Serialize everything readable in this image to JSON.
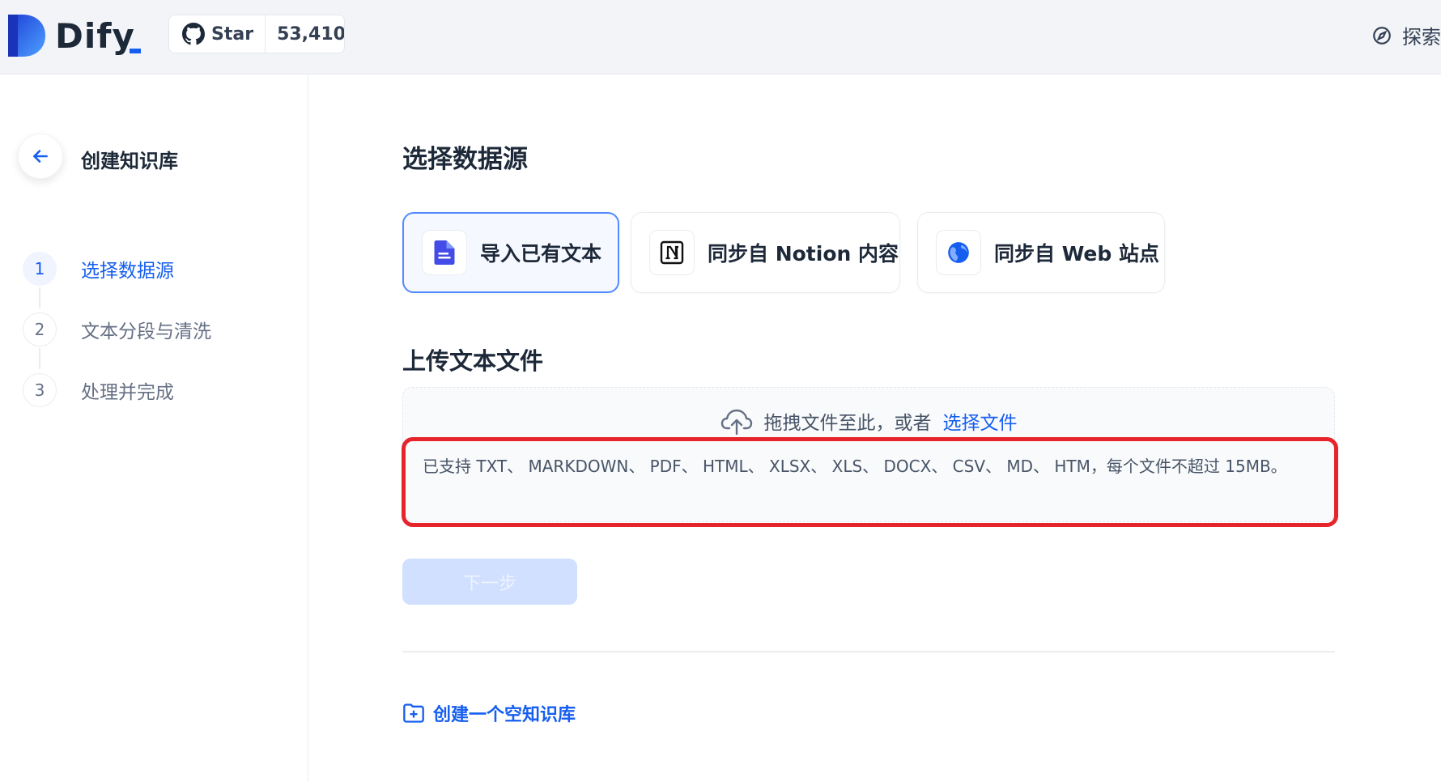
{
  "header": {
    "brand": "Dify",
    "github": {
      "star_label": "Star",
      "count": "53,410"
    },
    "explore_label": "探索"
  },
  "sidebar": {
    "title": "创建知识库",
    "steps": [
      {
        "num": "1",
        "label": "选择数据源",
        "active": true
      },
      {
        "num": "2",
        "label": "文本分段与清洗",
        "active": false
      },
      {
        "num": "3",
        "label": "处理并完成",
        "active": false
      }
    ]
  },
  "main": {
    "section_title": "选择数据源",
    "sources": [
      {
        "label": "导入已有文本",
        "icon": "file-icon",
        "active": true
      },
      {
        "label": "同步自 Notion 内容",
        "icon": "notion-icon",
        "active": false
      },
      {
        "label": "同步自 Web 站点",
        "icon": "globe-icon",
        "active": false
      }
    ],
    "upload_title": "上传文本文件",
    "dropzone": {
      "text": "拖拽文件至此，或者",
      "link": "选择文件",
      "supported": "已支持 TXT、 MARKDOWN、 PDF、 HTML、 XLSX、 XLS、 DOCX、 CSV、 MD、 HTM，每个文件不超过 15MB。"
    },
    "next_button": "下一步",
    "create_empty": "创建一个空知识库"
  },
  "colors": {
    "accent": "#155eef",
    "highlight": "#e6242b",
    "header_bg": "#f2f4f7"
  }
}
